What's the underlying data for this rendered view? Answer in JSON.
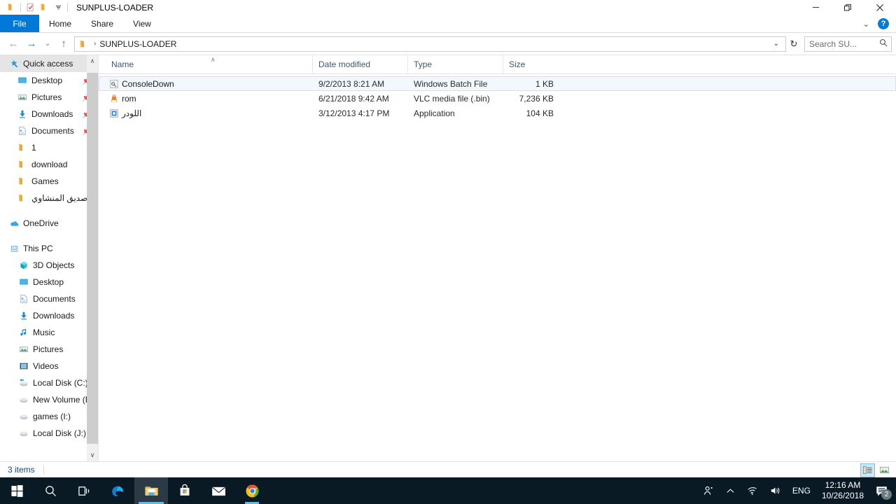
{
  "window": {
    "title": "SUNPLUS-LOADER",
    "quick_access_toolbar": [
      {
        "name": "folder-icon"
      },
      {
        "name": "properties-icon"
      },
      {
        "name": "new-folder-icon"
      },
      {
        "name": "customize-caret-icon"
      }
    ],
    "controls": {
      "minimize": "—",
      "restore": "❐",
      "close": "✕",
      "ribbon_collapse": "⌄",
      "help": "?"
    }
  },
  "ribbon": {
    "tabs": [
      {
        "label": "File",
        "active": true
      },
      {
        "label": "Home",
        "active": false
      },
      {
        "label": "Share",
        "active": false
      },
      {
        "label": "View",
        "active": false
      }
    ]
  },
  "addressbar": {
    "back": "←",
    "forward": "→",
    "recent": "⌄",
    "up": "↑",
    "crumb_separator": "›",
    "path": "SUNPLUS-LOADER",
    "dropdown": "⌄",
    "refresh": "↻",
    "search_placeholder": "Search SU...",
    "search_value": ""
  },
  "sidebar": {
    "groups": [
      {
        "header": {
          "label": "Quick access",
          "icon": "star-pin-icon",
          "selected": true
        },
        "items": [
          {
            "label": "Desktop",
            "icon": "desktop-icon",
            "pinned": true
          },
          {
            "label": "Pictures",
            "icon": "pictures-icon",
            "pinned": true
          },
          {
            "label": "Downloads",
            "icon": "downloads-icon",
            "pinned": true
          },
          {
            "label": "Documents",
            "icon": "documents-icon",
            "pinned": true
          },
          {
            "label": "1",
            "icon": "folder-icon",
            "pinned": false
          },
          {
            "label": "download",
            "icon": "folder-icon",
            "pinned": false
          },
          {
            "label": "Games",
            "icon": "folder-icon",
            "pinned": false
          },
          {
            "label": "صديق المنشاوي",
            "icon": "folder-icon",
            "pinned": false,
            "rtl": true
          }
        ]
      },
      {
        "header": {
          "label": "OneDrive",
          "icon": "onedrive-icon",
          "selected": false
        },
        "items": []
      },
      {
        "header": {
          "label": "This PC",
          "icon": "this-pc-icon",
          "selected": false
        },
        "items": [
          {
            "label": "3D Objects",
            "icon": "3d-objects-icon",
            "pinned": false
          },
          {
            "label": "Desktop",
            "icon": "desktop-icon",
            "pinned": false
          },
          {
            "label": "Documents",
            "icon": "documents-icon",
            "pinned": false
          },
          {
            "label": "Downloads",
            "icon": "downloads-icon",
            "pinned": false
          },
          {
            "label": "Music",
            "icon": "music-icon",
            "pinned": false
          },
          {
            "label": "Pictures",
            "icon": "pictures-icon",
            "pinned": false
          },
          {
            "label": "Videos",
            "icon": "videos-icon",
            "pinned": false
          },
          {
            "label": "Local Disk (C:)",
            "icon": "windows-drive-icon",
            "pinned": false
          },
          {
            "label": "New Volume (F:)",
            "icon": "drive-icon",
            "pinned": false
          },
          {
            "label": "games (I:)",
            "icon": "drive-icon",
            "pinned": false
          },
          {
            "label": "Local Disk (J:)",
            "icon": "drive-icon",
            "pinned": false
          }
        ]
      }
    ],
    "scroll": {
      "up_arrow": "∧",
      "down_arrow": "∨"
    }
  },
  "filelist": {
    "columns": [
      {
        "key": "name",
        "label": "Name",
        "sorted": true,
        "sort_caret": "∧"
      },
      {
        "key": "date",
        "label": "Date modified"
      },
      {
        "key": "type",
        "label": "Type"
      },
      {
        "key": "size",
        "label": "Size"
      }
    ],
    "rows": [
      {
        "name": "ConsoleDown",
        "date": "9/2/2013 8:21 AM",
        "type": "Windows Batch File",
        "size": "1 KB",
        "icon": "batch-file-icon",
        "selected": true,
        "rtl": false
      },
      {
        "name": "rom",
        "date": "6/21/2018 9:42 AM",
        "type": "VLC media file (.bin)",
        "size": "7,236 KB",
        "icon": "vlc-icon",
        "selected": false,
        "rtl": false
      },
      {
        "name": "اللودر",
        "date": "3/12/2013 4:17 PM",
        "type": "Application",
        "size": "104 KB",
        "icon": "application-icon",
        "selected": false,
        "rtl": true
      }
    ]
  },
  "statusbar": {
    "item_count": "3 items",
    "view_buttons": [
      {
        "name": "details-view-button",
        "active": true
      },
      {
        "name": "large-icons-view-button",
        "active": false
      }
    ]
  },
  "taskbar": {
    "buttons": [
      {
        "name": "start-button",
        "icon": "windows-logo-icon"
      },
      {
        "name": "search-button",
        "icon": "search-icon"
      },
      {
        "name": "task-view-button",
        "icon": "task-view-icon"
      },
      {
        "name": "edge-button",
        "icon": "edge-icon"
      },
      {
        "name": "file-explorer-button",
        "icon": "folder-icon",
        "active": true
      },
      {
        "name": "microsoft-store-button",
        "icon": "store-icon"
      },
      {
        "name": "mail-button",
        "icon": "mail-icon"
      },
      {
        "name": "chrome-button",
        "icon": "chrome-icon"
      }
    ],
    "tray": {
      "people_icon": "people-icon",
      "show_hidden_icon": "chevron-up-icon",
      "network_icon": "wifi-icon",
      "volume_icon": "speaker-icon",
      "language": "ENG",
      "time": "12:16 AM",
      "date": "10/26/2018",
      "action_center_badge": "2"
    }
  },
  "colors": {
    "accent": "#0078d7",
    "taskbar": "#0a1a24",
    "selection": "#f2f8fd",
    "selection_border": "#cce3f7",
    "header_text": "#42566b"
  }
}
